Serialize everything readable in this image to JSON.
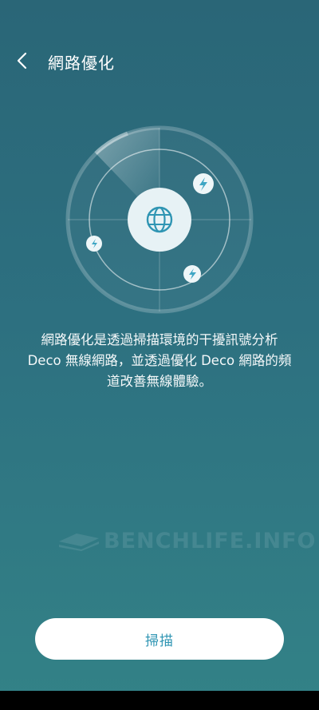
{
  "header": {
    "title": "網路優化"
  },
  "description": {
    "lines": [
      "網路優化是透過掃描環境的干擾訊號分析",
      "Deco 無線網路，並透過優化 Deco 網路的頻",
      "道改善無線體驗。"
    ]
  },
  "watermark": {
    "text": "BENCHLIFE.INFO"
  },
  "scan_button": {
    "label": "掃描"
  },
  "colors": {
    "background_top": "#2a6677",
    "background_bottom": "#338287",
    "accent": "#2f95b3",
    "button_bg": "#ffffff"
  },
  "icons": {
    "back": "chevron-left-icon",
    "center": "globe-icon",
    "interference": "lightning-icon"
  }
}
